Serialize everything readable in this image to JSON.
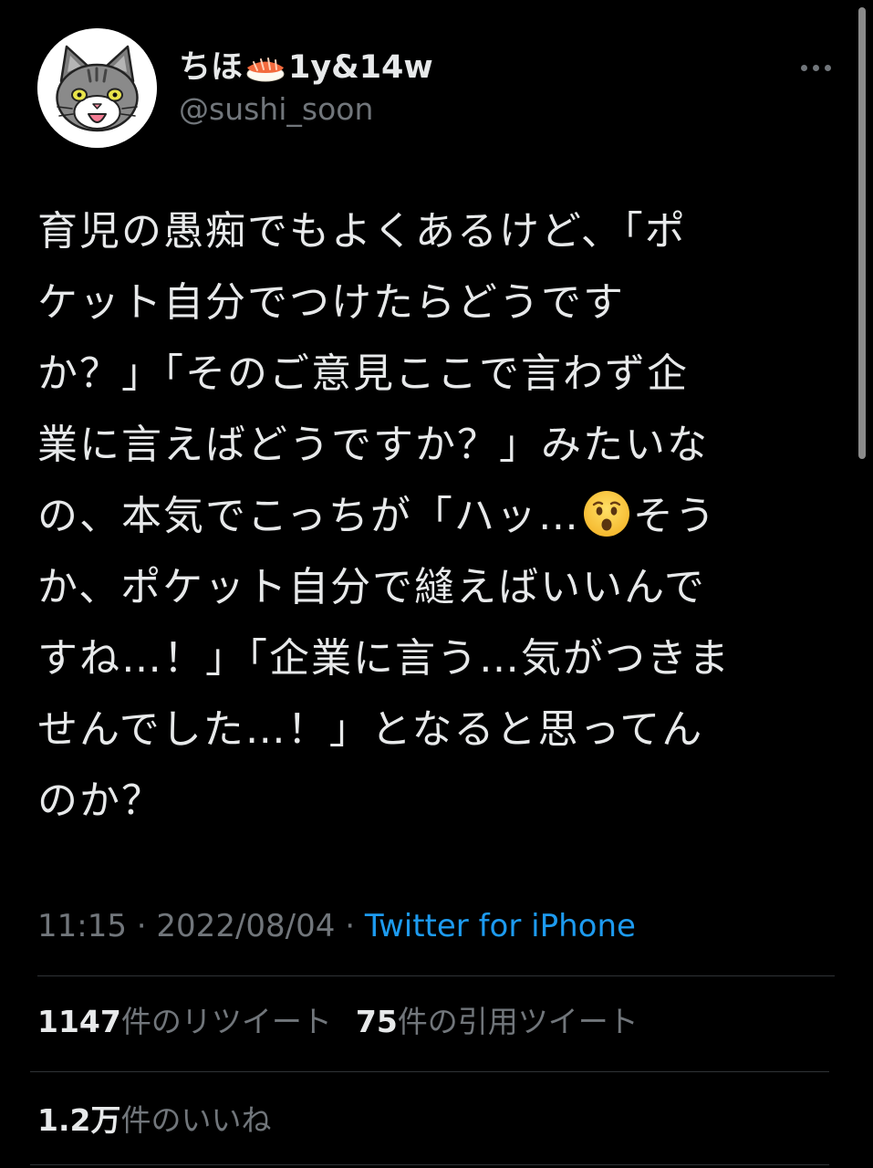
{
  "user": {
    "display_name_prefix": "ちほ",
    "display_name_suffix": "1y&14w",
    "display_name_emoji": "sushi-icon",
    "handle": "@sushi_soon",
    "avatar": "cat-avatar-icon"
  },
  "tweet": {
    "lines": [
      "育児の愚痴でもよくあるけど、「ポ",
      "ケット自分でつけたらどうです",
      "か？」「そのご意見ここで言わず企",
      "業に言えばどうですか？」みたいな",
      "の、本気でこっちが「ハッ…",
      "か、ポケット自分で縫えばいいんで",
      "すね…！」「企業に言う…気がつきま",
      "せんでした…！」となると思ってん",
      "のか？"
    ],
    "line5_after_emoji": "そう",
    "emoji": "hushed-face-icon"
  },
  "meta": {
    "time": "11:15",
    "separator": " · ",
    "date": "2022/08/04",
    "source": "Twitter for iPhone"
  },
  "stats": {
    "retweets_count": "1147",
    "retweets_label": "件のリツイート",
    "quotes_count": "75",
    "quotes_label": "件の引用ツイート",
    "likes_count": "1.2万",
    "likes_label": "件のいいね"
  },
  "colors": {
    "background": "#000000",
    "text": "#e7e9ea",
    "secondary": "#71767b",
    "link": "#1d9bf0",
    "divider": "#2f3336"
  }
}
